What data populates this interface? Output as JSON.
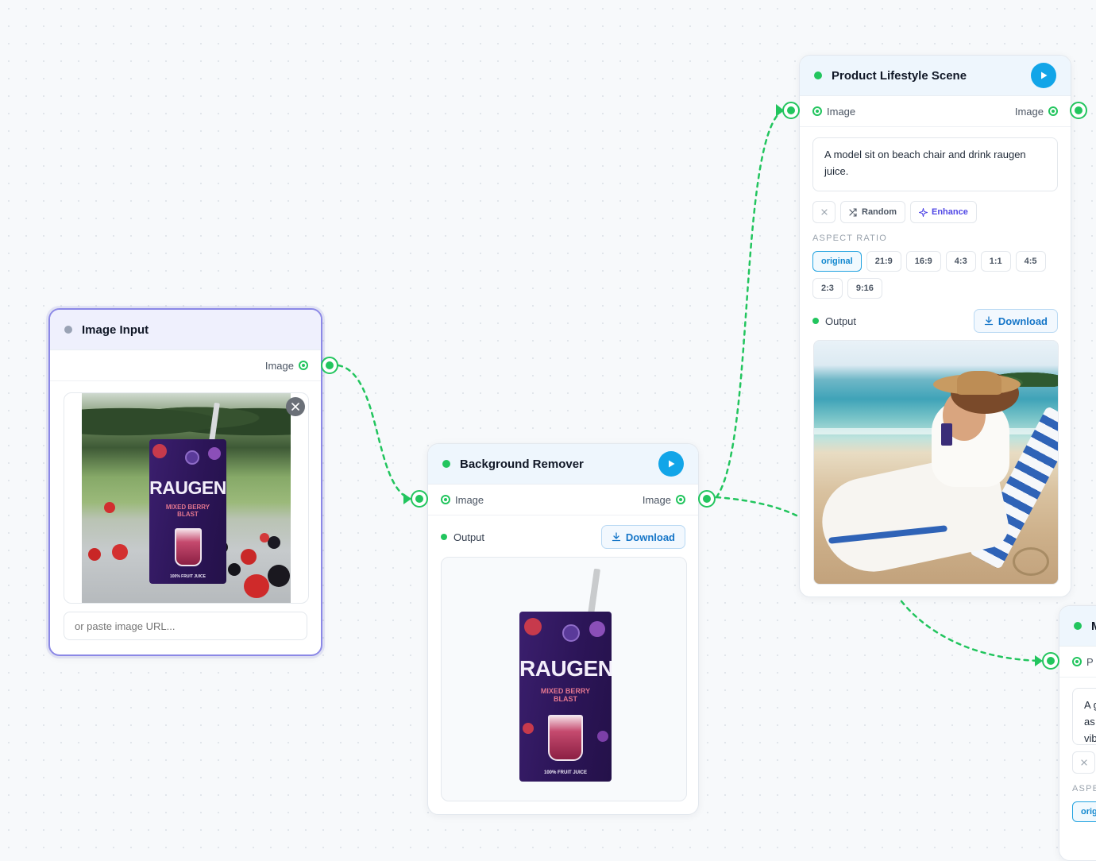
{
  "nodes": {
    "image_input": {
      "title": "Image Input",
      "output_port_label": "Image",
      "url_placeholder": "or paste image URL...",
      "product": {
        "brand": "RAUGEN",
        "flavor": "MIXED BERRY BLAST",
        "tagline": "100% FRUIT JUICE"
      }
    },
    "background_remover": {
      "title": "Background Remover",
      "input_port_label": "Image",
      "output_port_label": "Image",
      "output_label": "Output",
      "download_label": "Download",
      "product": {
        "brand": "RAUGEN",
        "flavor": "MIXED BERRY BLAST",
        "tagline": "100% FRUIT JUICE"
      }
    },
    "product_lifestyle_scene": {
      "title": "Product Lifestyle Scene",
      "input_port_label": "Image",
      "output_port_label": "Image",
      "prompt_text": "A model sit on beach chair and drink raugen juice.",
      "random_label": "Random",
      "enhance_label": "Enhance",
      "aspect_ratio_label": "ASPECT RATIO",
      "aspect_ratios": [
        "original",
        "21:9",
        "16:9",
        "4:3",
        "1:1",
        "4:5",
        "2:3",
        "9:16"
      ],
      "selected_aspect_ratio": "original",
      "output_label": "Output",
      "download_label": "Download"
    },
    "partial_node": {
      "title_fragment": "M",
      "port_fragment": "P",
      "text_fragments": [
        "A g",
        "as",
        "vib"
      ],
      "section_fragment": "ASPE",
      "chip_fragment": "orig"
    }
  },
  "colors": {
    "port_green": "#22c55e",
    "run_blue": "#12a5e8",
    "selected_outline": "#8b88e6",
    "download_blue": "#1676c8"
  },
  "icons": [
    "play-icon",
    "download-icon",
    "close-icon",
    "shuffle-icon",
    "sparkle-icon"
  ]
}
